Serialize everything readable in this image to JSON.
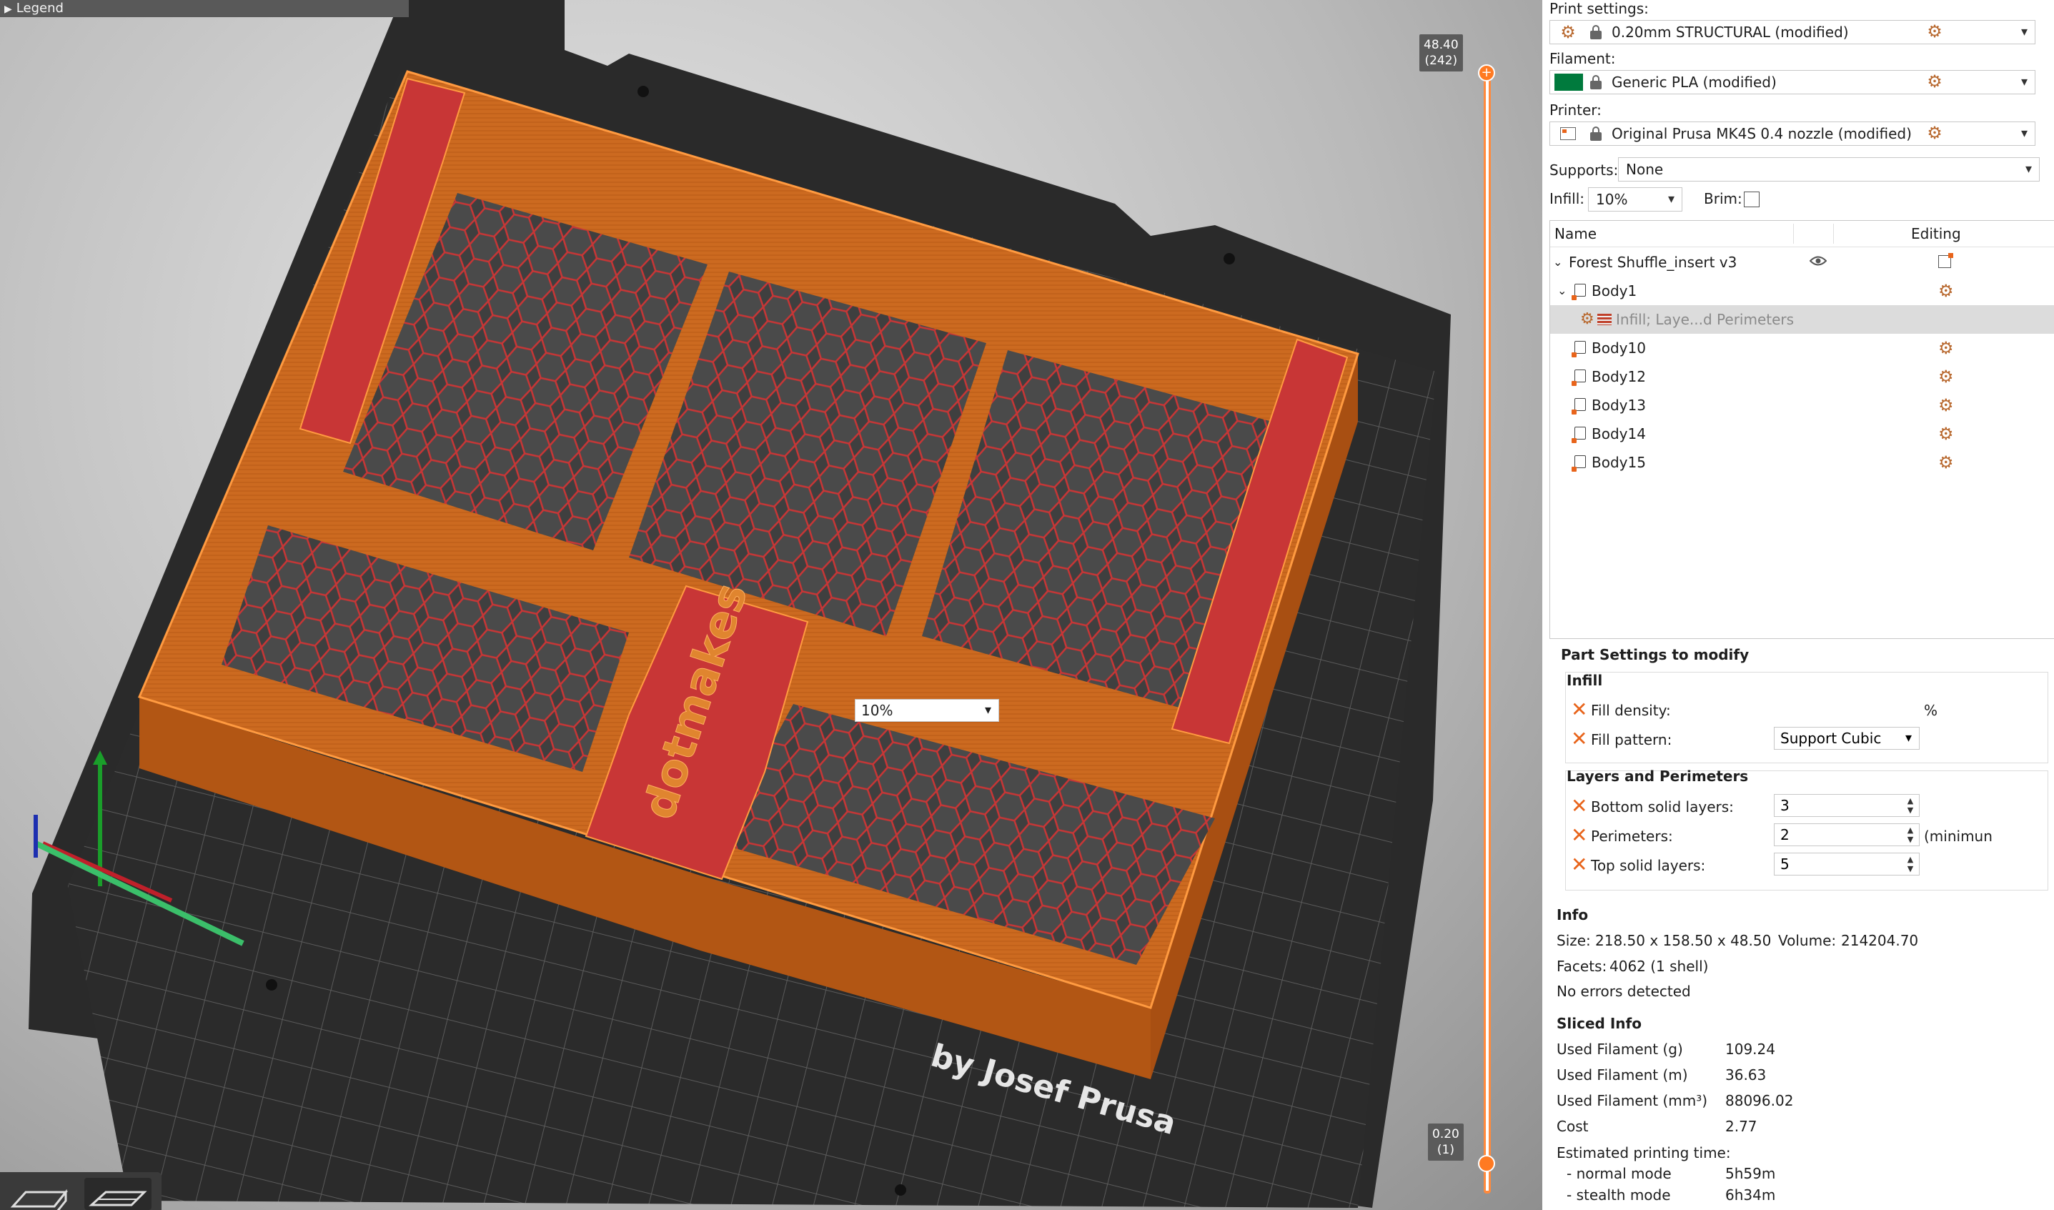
{
  "viewport": {
    "legend_label": "Legend",
    "layer_top": {
      "height": "48.40",
      "index": "(242)"
    },
    "layer_bottom": {
      "height": "0.20",
      "index": "(1)"
    },
    "logo_text": "dotmakes",
    "bed_text": "by Josef Prusa",
    "colors": {
      "model": "#d2691e",
      "infill": "#c83636",
      "bed": "#2b2b2b"
    }
  },
  "settings": {
    "print_settings_label": "Print settings:",
    "print_settings_value": "0.20mm STRUCTURAL (modified)",
    "filament_label": "Filament:",
    "filament_value": "Generic PLA (modified)",
    "filament_color": "#007a3d",
    "printer_label": "Printer:",
    "printer_value": "Original Prusa MK4S 0.4 nozzle (modified)",
    "supports_label": "Supports:",
    "supports_value": "None",
    "infill_label": "Infill:",
    "infill_value": "10%",
    "brim_label": "Brim:"
  },
  "object_list": {
    "col_name": "Name",
    "col_editing": "Editing",
    "root": "Forest Shuffle_insert v3",
    "items": [
      {
        "name": "Body1"
      },
      {
        "name": "Infill; Laye...d Perimeters"
      },
      {
        "name": "Body10"
      },
      {
        "name": "Body12"
      },
      {
        "name": "Body13"
      },
      {
        "name": "Body14"
      },
      {
        "name": "Body15"
      }
    ]
  },
  "part_settings": {
    "title": "Part Settings to modify",
    "infill_group": "Infill",
    "fill_density_label": "Fill density:",
    "fill_density_value": "10%",
    "fill_density_unit": "%",
    "fill_pattern_label": "Fill pattern:",
    "fill_pattern_value": "Support Cubic",
    "layers_group": "Layers and Perimeters",
    "bottom_label": "Bottom solid layers:",
    "bottom_value": "3",
    "perimeters_label": "Perimeters:",
    "perimeters_value": "2",
    "perimeters_note": "(minimun",
    "top_label": "Top solid layers:",
    "top_value": "5"
  },
  "info": {
    "title": "Info",
    "size_label": "Size:",
    "size_value": "218.50 x 158.50 x 48.50",
    "volume_label": "Volume:",
    "volume_value": "214204.70",
    "facets_label": "Facets:",
    "facets_value": "4062 (1 shell)",
    "errors": "No errors detected"
  },
  "sliced": {
    "title": "Sliced Info",
    "rows": [
      {
        "label": "Used Filament (g)",
        "value": "109.24"
      },
      {
        "label": "Used Filament (m)",
        "value": "36.63"
      },
      {
        "label": "Used Filament (mm³)",
        "value": "88096.02"
      },
      {
        "label": "Cost",
        "value": "2.77"
      }
    ],
    "time_label": "Estimated printing time:",
    "normal_label": "- normal mode",
    "normal_value": "5h59m",
    "stealth_label": "- stealth mode",
    "stealth_value": "6h34m"
  }
}
